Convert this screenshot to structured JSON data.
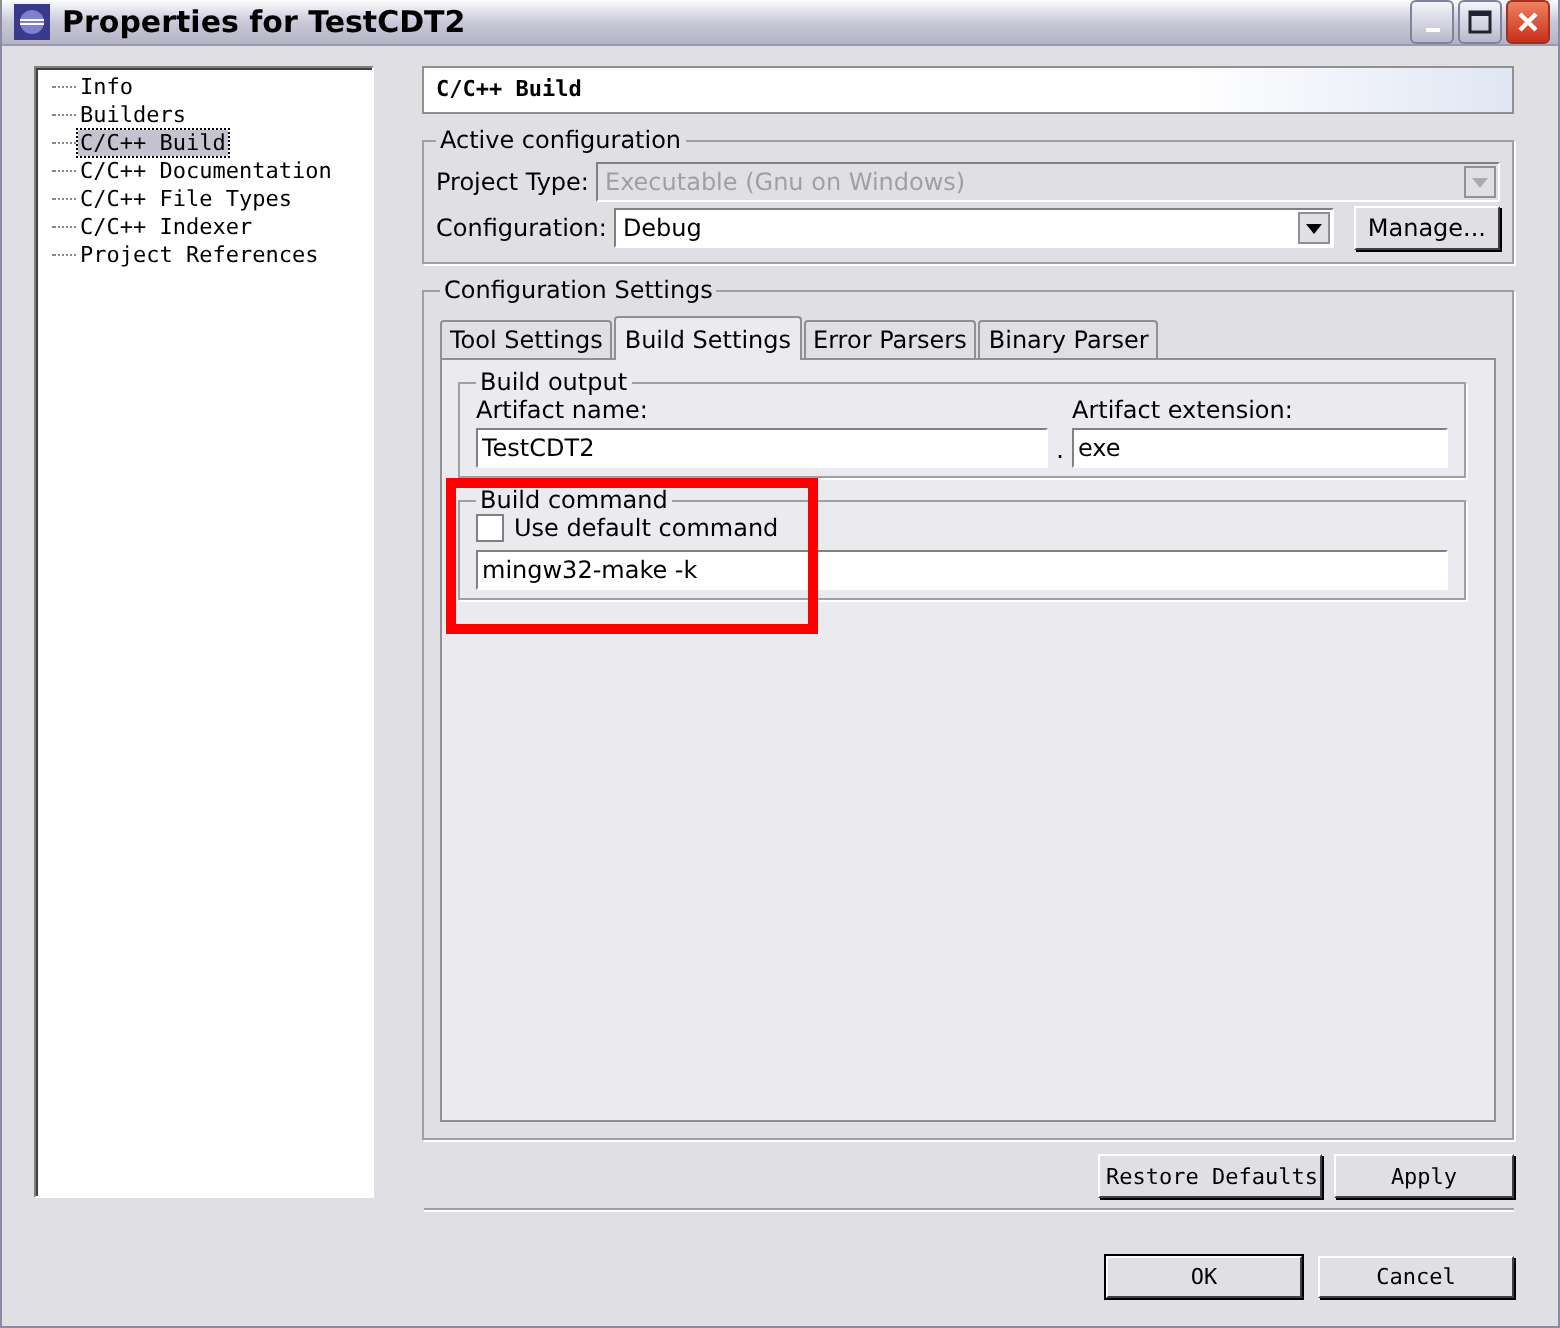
{
  "window": {
    "title": "Properties for TestCDT2"
  },
  "sidebar": {
    "items": [
      {
        "label": "Info",
        "selected": false
      },
      {
        "label": "Builders",
        "selected": false
      },
      {
        "label": "C/C++ Build",
        "selected": true
      },
      {
        "label": "C/C++ Documentation",
        "selected": false
      },
      {
        "label": "C/C++ File Types",
        "selected": false
      },
      {
        "label": "C/C++ Indexer",
        "selected": false
      },
      {
        "label": "Project References",
        "selected": false
      }
    ]
  },
  "page_title": "C/C++ Build",
  "active_configuration": {
    "title": "Active configuration",
    "project_type_label": "Project Type:",
    "project_type": "Executable (Gnu on Windows)",
    "project_type_disabled": true,
    "configuration_label": "Configuration:",
    "configuration": "Debug",
    "manage_button": "Manage..."
  },
  "configuration_settings": {
    "title": "Configuration Settings",
    "tabs": [
      {
        "label": "Tool Settings",
        "selected": false
      },
      {
        "label": "Build Settings",
        "selected": true
      },
      {
        "label": "Error Parsers",
        "selected": false
      },
      {
        "label": "Binary Parser",
        "selected": false
      }
    ],
    "build_output": {
      "title": "Build output",
      "artifact_name_label": "Artifact name:",
      "artifact_name": "TestCDT2",
      "separator": ".",
      "artifact_extension_label": "Artifact extension:",
      "artifact_extension": "exe"
    },
    "build_command": {
      "title": "Build command",
      "highlighted": true,
      "use_default_label": "Use default command",
      "use_default_checked": false,
      "command": "mingw32-make -k"
    }
  },
  "page_buttons": [
    "Restore Defaults",
    "Apply"
  ],
  "dialog_buttons": [
    {
      "label": "OK",
      "default": true
    },
    {
      "label": "Cancel",
      "default": false
    }
  ]
}
